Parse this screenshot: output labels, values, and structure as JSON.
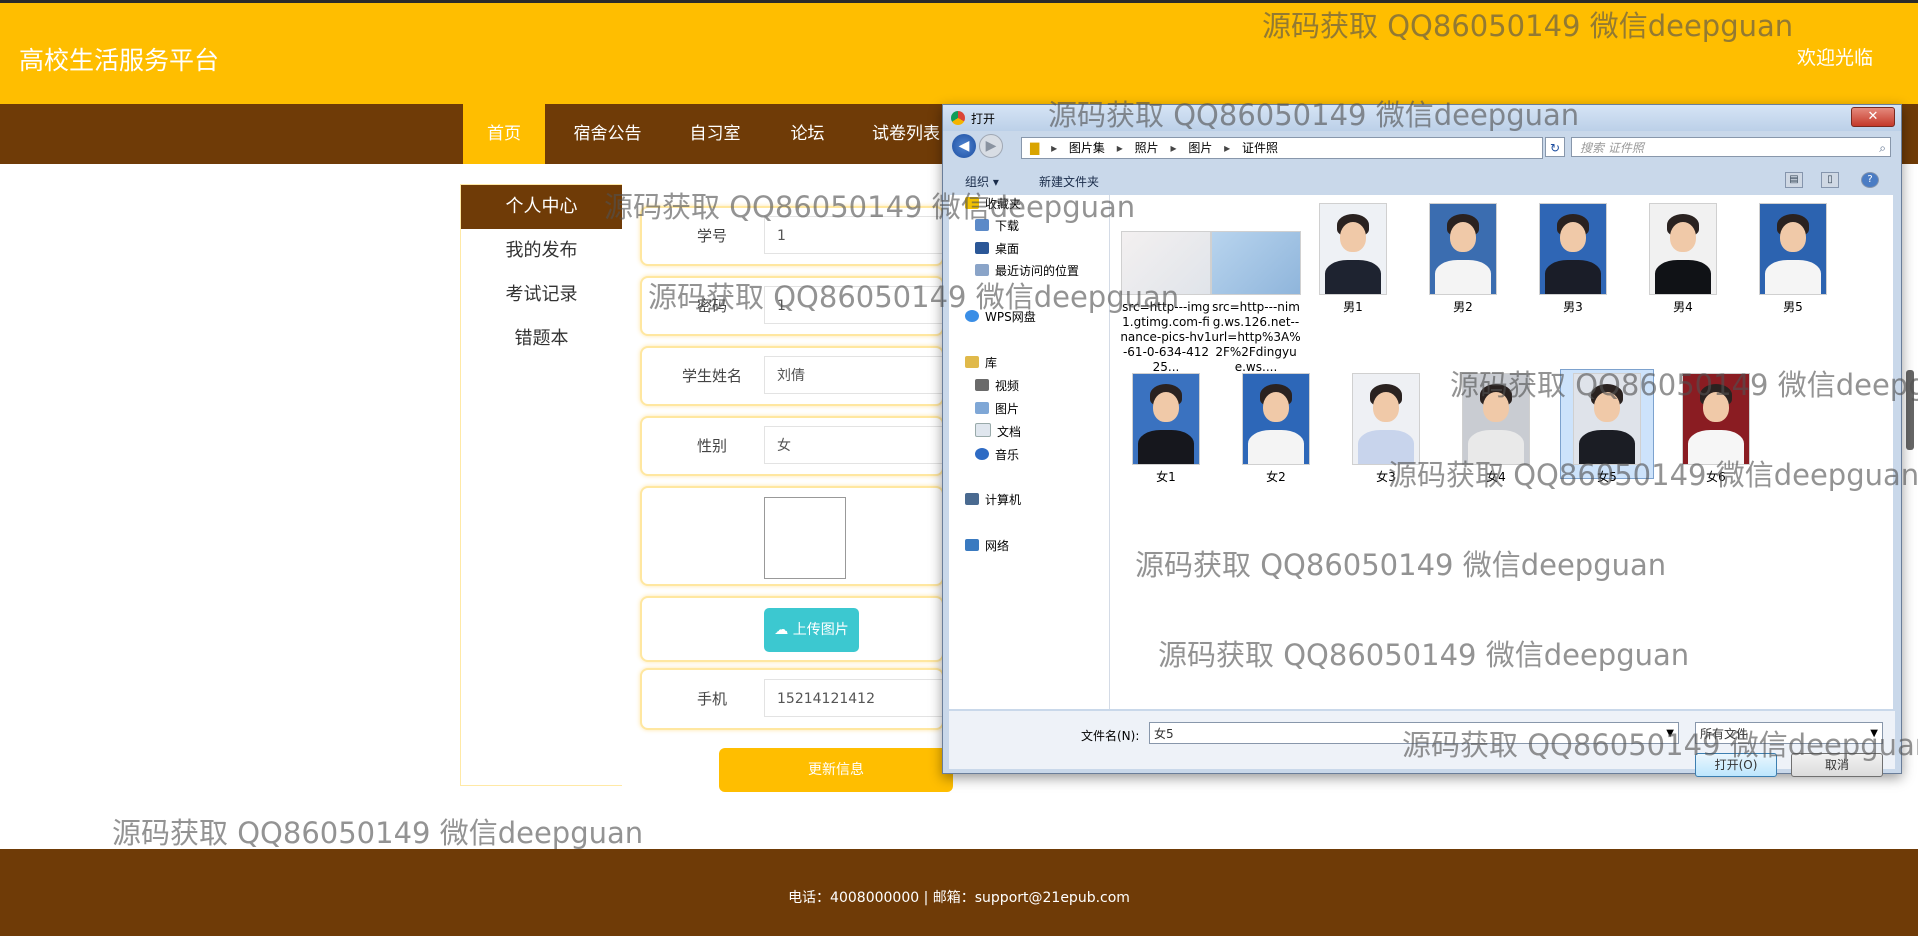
{
  "site": {
    "title": "高校生活服务平台",
    "welcome": "欢迎光临"
  },
  "nav": {
    "items": [
      {
        "label": "首页",
        "active": true
      },
      {
        "label": "宿舍公告"
      },
      {
        "label": "自习室"
      },
      {
        "label": "论坛"
      },
      {
        "label": "试卷列表"
      }
    ]
  },
  "sidebar": {
    "items": [
      {
        "label": "个人中心",
        "active": true
      },
      {
        "label": "我的发布"
      },
      {
        "label": "考试记录"
      },
      {
        "label": "错题本"
      }
    ]
  },
  "form": {
    "student_id_label": "学号",
    "student_id_value": "1",
    "password_label": "密码",
    "password_value": "1",
    "name_label": "学生姓名",
    "name_value": "刘倩",
    "gender_label": "性别",
    "gender_value": "女",
    "upload_label": "上传图片",
    "phone_label": "手机",
    "phone_value": "15214121412",
    "update_label": "更新信息"
  },
  "footer": {
    "text": "电话：4008000000 | 邮箱：support@21epub.com"
  },
  "dialog": {
    "title": "打开",
    "close_label": "✕",
    "breadcrumb": [
      "图片集",
      "照片",
      "图片",
      "证件照"
    ],
    "search_placeholder": "搜索 证件照",
    "toolbar": {
      "organize": "组织",
      "new_folder": "新建文件夹"
    },
    "nav_pane": {
      "favorites": "收藏夹",
      "downloads": "下载",
      "desktop": "桌面",
      "recent": "最近访问的位置",
      "wps": "WPS网盘",
      "library": "库",
      "videos": "视频",
      "pictures": "图片",
      "documents": "文档",
      "music": "音乐",
      "computer": "计算机",
      "network": "网络"
    },
    "files": [
      {
        "name": "src=http---img1.gtimg.com-finance-pics-hv1-61-0-634-41225..."
      },
      {
        "name": "src=http---nimg.ws.126.net--url=http%3A%2F%2Fdingyue.ws...."
      },
      {
        "name": "男1"
      },
      {
        "name": "男2"
      },
      {
        "name": "男3"
      },
      {
        "name": "男4"
      },
      {
        "name": "男5"
      },
      {
        "name": "女1"
      },
      {
        "name": "女2"
      },
      {
        "name": "女3"
      },
      {
        "name": "女4"
      },
      {
        "name": "女5",
        "selected": true
      },
      {
        "name": "女6"
      }
    ],
    "filename_label": "文件名(N):",
    "filename_value": "女5",
    "filter_value": "所有文件",
    "open_label": "打开(O)",
    "cancel_label": "取消"
  },
  "watermark": "源码获取 QQ86050149 微信deepguan"
}
